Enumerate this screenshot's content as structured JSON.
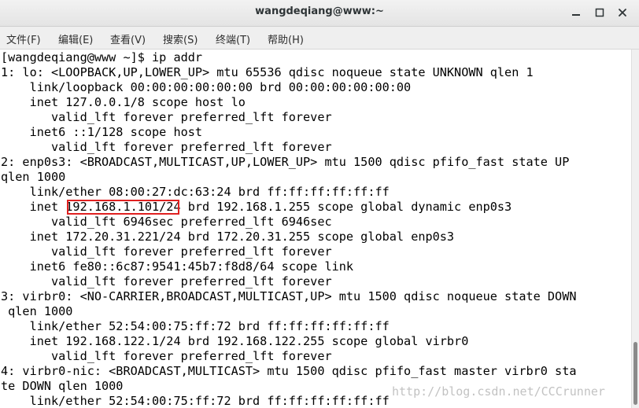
{
  "window": {
    "title": "wangdeqiang@www:~"
  },
  "menu": [
    {
      "label": "文件(F)"
    },
    {
      "label": "编辑(E)"
    },
    {
      "label": "查看(V)"
    },
    {
      "label": "搜索(S)"
    },
    {
      "label": "终端(T)"
    },
    {
      "label": "帮助(H)"
    }
  ],
  "terminal": {
    "lines": [
      "[wangdeqiang@www ~]$ ip addr",
      "1: lo: <LOOPBACK,UP,LOWER_UP> mtu 65536 qdisc noqueue state UNKNOWN qlen 1",
      "    link/loopback 00:00:00:00:00:00 brd 00:00:00:00:00:00",
      "    inet 127.0.0.1/8 scope host lo",
      "       valid_lft forever preferred_lft forever",
      "    inet6 ::1/128 scope host",
      "       valid_lft forever preferred_lft forever",
      "2: enp0s3: <BROADCAST,MULTICAST,UP,LOWER_UP> mtu 1500 qdisc pfifo_fast state UP",
      "qlen 1000",
      "    link/ether 08:00:27:dc:63:24 brd ff:ff:ff:ff:ff:ff",
      "    inet 192.168.1.101/24 brd 192.168.1.255 scope global dynamic enp0s3",
      "       valid_lft 6946sec preferred_lft 6946sec",
      "    inet 172.20.31.221/24 brd 172.20.31.255 scope global enp0s3",
      "       valid_lft forever preferred_lft forever",
      "    inet6 fe80::6c87:9541:45b7:f8d8/64 scope link",
      "       valid_lft forever preferred_lft forever",
      "3: virbr0: <NO-CARRIER,BROADCAST,MULTICAST,UP> mtu 1500 qdisc noqueue state DOWN",
      " qlen 1000",
      "    link/ether 52:54:00:75:ff:72 brd ff:ff:ff:ff:ff:ff",
      "    inet 192.168.122.1/24 brd 192.168.122.255 scope global virbr0",
      "       valid_lft forever preferred_lft forever",
      "4: virbr0-nic: <BROADCAST,MULTICAST> mtu 1500 qdisc pfifo_fast master virbr0 sta",
      "te DOWN qlen 1000",
      "    link/ether 52:54:00:75:ff:72 brd ff:ff:ff:ff:ff:ff"
    ]
  },
  "watermark": "http://blog.csdn.net/CCCrunner",
  "colors": {
    "highlight": "#e02020",
    "terminal_bg": "#ffffff",
    "terminal_fg": "#000000"
  }
}
